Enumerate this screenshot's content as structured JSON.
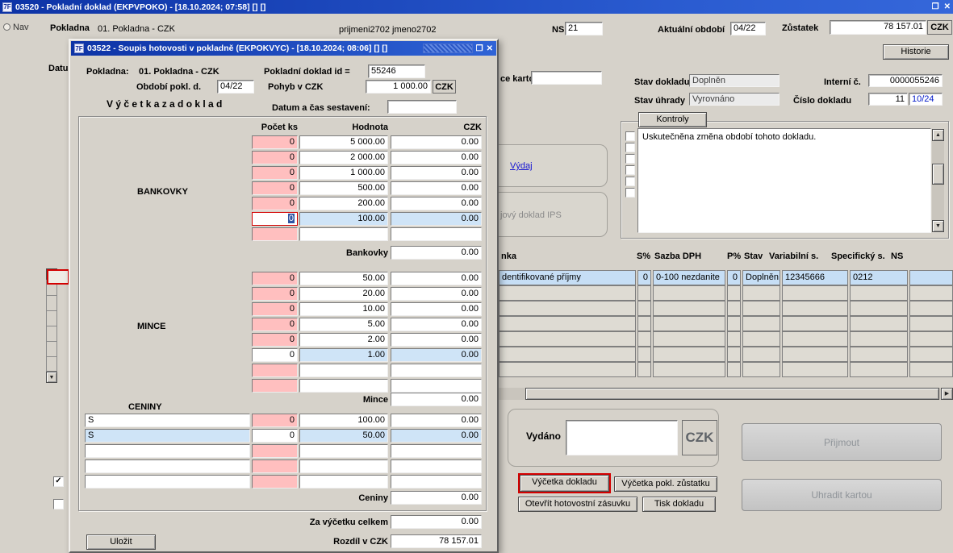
{
  "colors": {
    "pink_cell": "#ffbfbf",
    "highlight_blue": "#cfe4f7",
    "focus_red": "#d40000",
    "titlebar_blue": "#1c4bc4",
    "link_blue": "#1414d2"
  },
  "icons": {
    "app_icon_text": "7F",
    "close": "✕",
    "restore": "❐",
    "arrow_up": "▲",
    "arrow_down": "▼",
    "arrow_right": "▶",
    "check": "✓"
  },
  "main": {
    "title": "03520 - Pokladní doklad (EKPVPOKO) - [18.10.2024; 07:58]  []  []",
    "nav_label": "Nav",
    "datum_fragment": "Datu",
    "header": {
      "pokladna_label": "Pokladna",
      "pokladna_value": "01. Pokladna - CZK",
      "user": "prijmeni2702 jmeno2702",
      "ns_label": "NS",
      "ns_value": "21",
      "obdobi_label": "Aktuální období",
      "obdobi_value": "04/22",
      "zustatek_label": "Zůstatek",
      "zustatek_value": "78 157.01",
      "currency": "CZK"
    },
    "historie_button": "Historie",
    "right_panel": {
      "karta_fragment": "ce kartou",
      "stav_dokladu_label": "Stav dokladu",
      "stav_dokladu_value": "Doplněn",
      "interni_c_label": "Interní č.",
      "interni_c_value": "0000055246",
      "stav_uhrady_label": "Stav úhrady",
      "stav_uhrady_value": "Vyrovnáno",
      "cislo_dokladu_label": "Číslo dokladu",
      "cislo_dokladu_value": "11",
      "cislo_dokladu_obdobi": "10/24",
      "kontroly_button": "Kontroly",
      "kontroly_item": "Uskutečněna změna období tohoto dokladu.",
      "vydaj_link": "Výdaj",
      "ips_fragment": "jový doklad IPS"
    },
    "table": {
      "headers": [
        "nka",
        "S%",
        "Sazba DPH",
        "P%",
        "Stav",
        "Variabilní s.",
        "Specifický s.",
        "NS"
      ],
      "row": [
        "dentifikované příjmy",
        "0",
        "0-100 nezdanite",
        "0",
        "Doplněn",
        "12345666",
        "0212",
        ""
      ]
    },
    "payment": {
      "vydano_label": "Vydáno",
      "currency": "CZK",
      "prijmout_button": "Přijmout",
      "uhradit_button": "Uhradit kartou"
    },
    "buttons": {
      "vycetka_dokladu": "Výčetka dokladu",
      "vycetka_zustatku": "Výčetka pokl. zůstatku",
      "otevrit_zasuvku": "Otevřít hotovostní zásuvku",
      "tisk_dokladu": "Tisk dokladu"
    }
  },
  "dialog": {
    "title": "03522 - Soupis hotovosti v pokladně (EKPOKVYC) - [18.10.2024; 08:06]  []  []",
    "pokladna_label": "Pokladna:",
    "pokladna_value": "01. Pokladna - CZK",
    "doklad_id_label": "Pokladní doklad id =",
    "doklad_id_value": "55246",
    "obdobi_label": "Období pokl. d.",
    "obdobi_value": "04/22",
    "pohyb_label": "Pohyb v CZK",
    "pohyb_value": "1 000.00",
    "currency": "CZK",
    "vycetka_title": "V ý č e t k a   z a   d o k l a d",
    "datum_cas_label": "Datum a čas sestavení:",
    "datum_cas_value": "",
    "col_pocet": "Počet ks",
    "col_hodnota": "Hodnota",
    "col_czk": "CZK",
    "bankovky": {
      "label": "BANKOVKY",
      "rows": [
        {
          "count": "0",
          "value": "5 000.00",
          "czk": "0.00"
        },
        {
          "count": "0",
          "value": "2 000.00",
          "czk": "0.00"
        },
        {
          "count": "0",
          "value": "1 000.00",
          "czk": "0.00"
        },
        {
          "count": "0",
          "value": "500.00",
          "czk": "0.00"
        },
        {
          "count": "0",
          "value": "200.00",
          "czk": "0.00"
        },
        {
          "count": "0",
          "value": "100.00",
          "czk": "0.00"
        },
        {
          "count": "",
          "value": "",
          "czk": ""
        }
      ],
      "total_label": "Bankovky",
      "total": "0.00"
    },
    "mince": {
      "label": "MINCE",
      "rows": [
        {
          "count": "0",
          "value": "50.00",
          "czk": "0.00"
        },
        {
          "count": "0",
          "value": "20.00",
          "czk": "0.00"
        },
        {
          "count": "0",
          "value": "10.00",
          "czk": "0.00"
        },
        {
          "count": "0",
          "value": "5.00",
          "czk": "0.00"
        },
        {
          "count": "0",
          "value": "2.00",
          "czk": "0.00"
        },
        {
          "count": "0",
          "value": "1.00",
          "czk": "0.00"
        },
        {
          "count": "",
          "value": "",
          "czk": ""
        },
        {
          "count": "",
          "value": "",
          "czk": ""
        }
      ],
      "total_label": "Mince",
      "total": "0.00"
    },
    "ceniny": {
      "label": "CENINY",
      "rows": [
        {
          "text": "S",
          "count": "0",
          "value": "100.00",
          "czk": "0.00"
        },
        {
          "text": "S",
          "count": "0",
          "value": "50.00",
          "czk": "0.00"
        },
        {
          "text": "",
          "count": "",
          "value": "",
          "czk": ""
        },
        {
          "text": "",
          "count": "",
          "value": "",
          "czk": ""
        },
        {
          "text": "",
          "count": "",
          "value": "",
          "czk": ""
        }
      ],
      "total_label": "Ceniny",
      "total": "0.00"
    },
    "za_vycetku_label": "Za výčetku celkem",
    "za_vycetku_value": "0.00",
    "rozdil_label": "Rozdíl v CZK",
    "rozdil_value": "78 157.01",
    "ulozit_button": "Uložit"
  }
}
